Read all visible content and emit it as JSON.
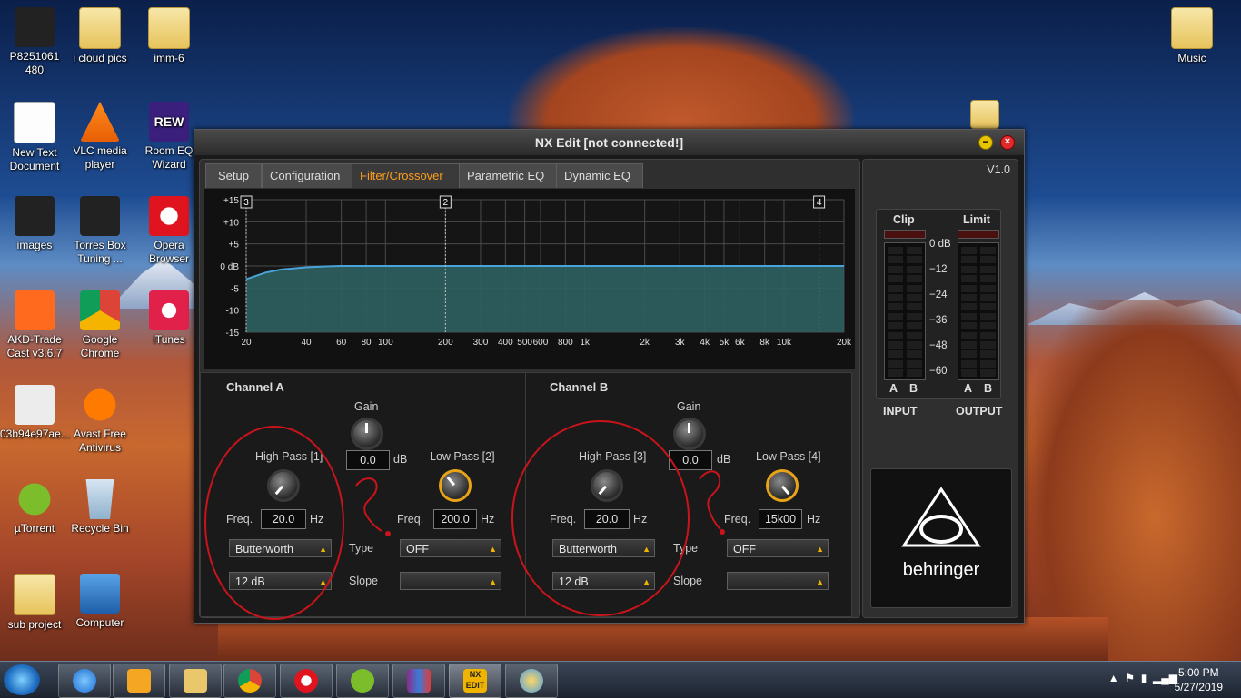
{
  "desktop": {
    "icons": [
      {
        "label": "P8251061 480",
        "icon": "photo-icon"
      },
      {
        "label": "i cloud pics",
        "icon": "folder-icon"
      },
      {
        "label": "imm-6",
        "icon": "folder-icon"
      },
      {
        "label": "New Text Document",
        "icon": "text-document-icon"
      },
      {
        "label": "VLC media player",
        "icon": "vlc-icon"
      },
      {
        "label": "Room EQ Wizard",
        "icon": "rew-icon"
      },
      {
        "label": "images",
        "icon": "image-icon"
      },
      {
        "label": "Torres Box Tuning ...",
        "icon": "waveform-icon"
      },
      {
        "label": "Opera Browser",
        "icon": "opera-icon"
      },
      {
        "label": "AKD-Trade Cast v3.6.7",
        "icon": "akd-icon"
      },
      {
        "label": "Google Chrome",
        "icon": "chrome-icon"
      },
      {
        "label": "iTunes",
        "icon": "itunes-icon"
      },
      {
        "label": "03b94e97ae...",
        "icon": "image-icon"
      },
      {
        "label": "Avast Free Antivirus",
        "icon": "avast-icon"
      },
      {
        "label": "µTorrent",
        "icon": "utorrent-icon"
      },
      {
        "label": "Recycle Bin",
        "icon": "recycle-bin-icon"
      },
      {
        "label": "sub project",
        "icon": "folder-icon"
      },
      {
        "label": "Computer",
        "icon": "computer-icon"
      },
      {
        "label": "Music",
        "icon": "folder-icon"
      }
    ],
    "rew_badge": "REW"
  },
  "window": {
    "title": "NX Edit [not connected!]",
    "minimize": "−",
    "close": "×",
    "tabs": [
      "Setup",
      "Configuration",
      "Filter/Crossover",
      "Parametric EQ",
      "Dynamic EQ"
    ],
    "active_tab": "Filter/Crossover"
  },
  "graph": {
    "y_ticks": [
      "+15",
      "+10",
      "+5",
      "0 dB",
      "-5",
      "-10",
      "-15"
    ],
    "x_ticks": [
      "20",
      "40",
      "60",
      "80",
      "100",
      "200",
      "300",
      "400",
      "500",
      "600",
      "800",
      "1k",
      "2k",
      "3k",
      "4k",
      "5k",
      "6k",
      "8k",
      "10k",
      "20k"
    ],
    "markers": [
      "3",
      "2",
      "4"
    ]
  },
  "chart_data": {
    "type": "area",
    "xscale": "log",
    "xlim": [
      20,
      20000
    ],
    "ylim": [
      -15,
      15
    ],
    "x": [
      20,
      25,
      30,
      40,
      50,
      60,
      80,
      100,
      200,
      1000,
      10000,
      20000
    ],
    "y": [
      -3,
      -1.5,
      -0.8,
      -0.3,
      -0.1,
      0,
      0,
      0,
      0,
      0,
      0,
      0
    ],
    "grid": true
  },
  "channel_a": {
    "title": "Channel A",
    "gain_label": "Gain",
    "gain_value": "0.0",
    "gain_unit": "dB",
    "hp_label": "High Pass [1]",
    "lp_label": "Low Pass [2]",
    "freq_label": "Freq.",
    "hp_freq": "20.0",
    "lp_freq": "200.0",
    "unit_hz": "Hz",
    "hp_type": "Butterworth",
    "hp_slope": "12 dB",
    "type_label": "Type",
    "slope_label": "Slope",
    "lp_type": "OFF",
    "lp_slope": ""
  },
  "channel_b": {
    "title": "Channel B",
    "gain_label": "Gain",
    "gain_value": "0.0",
    "gain_unit": "dB",
    "hp_label": "High Pass [3]",
    "lp_label": "Low Pass [4]",
    "freq_label": "Freq.",
    "hp_freq": "20.0",
    "lp_freq": "15k00",
    "unit_hz": "Hz",
    "hp_type": "Butterworth",
    "hp_slope": "12 dB",
    "type_label": "Type",
    "slope_label": "Slope",
    "lp_type": "OFF",
    "lp_slope": ""
  },
  "meters": {
    "version": "V1.0",
    "clip": "Clip",
    "limit": "Limit",
    "scale": [
      "0 dB",
      "−12",
      "−24",
      "−36",
      "−48",
      "−60"
    ],
    "a": "A",
    "b": "B",
    "input": "INPUT",
    "output": "OUTPUT",
    "brand": "behringer"
  },
  "taskbar": {
    "apps": [
      "windows-explorer-icon",
      "internet-explorer-icon",
      "media-player-icon",
      "file-explorer-icon",
      "chrome-icon",
      "opera-icon",
      "utorrent-icon",
      "winrar-icon",
      "nx-edit-icon",
      "paint-icon"
    ],
    "nx_badge": "NX\nEDIT",
    "time": "5:00 PM",
    "date": "5/27/2019"
  },
  "colors": {
    "accent_orange": "#ff9d1c",
    "curve_fill": "#2e5f5f",
    "curve_line": "#4aa3d8",
    "annotation_red": "#c8141a"
  }
}
